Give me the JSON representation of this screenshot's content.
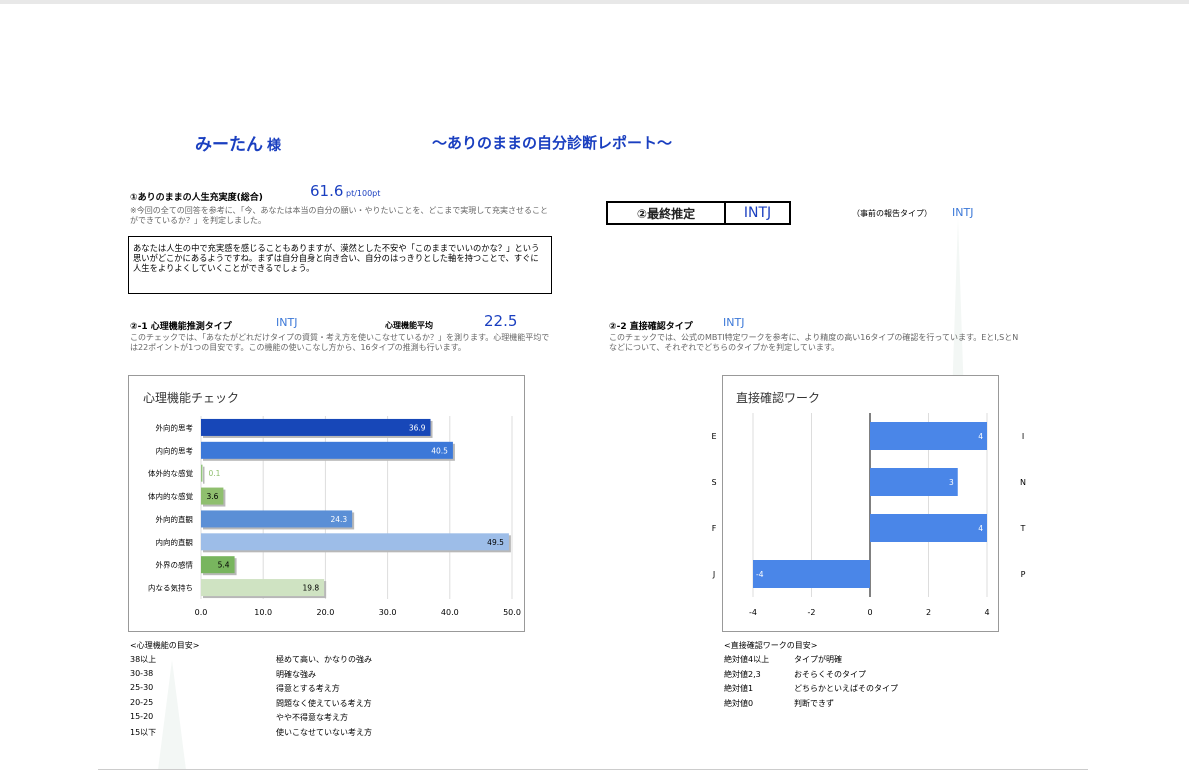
{
  "header": {
    "name": "みーたん",
    "honorific": "様",
    "title": "～ありのままの自分診断レポート～"
  },
  "section1": {
    "heading": "①ありのままの人生充実度(総合)",
    "score": "61.6",
    "unit": "pt/100pt",
    "note": "※今回の全ての回答を参考に、「今、あなたは本当の自分の願い・やりたいことを、どこまで実現して充実させることができているか？」を判定しました。",
    "message": "あなたは人生の中で充実感を感じることもありますが、漠然とした不安や「このままでいいのかな？」という思いがどこかにあるようですね。まずは自分自身と向き合い、自分のはっきりとした軸を持つことで、すぐに人生をよりよくしていくことができるでしょう。"
  },
  "section2": {
    "final_label": "②最終推定",
    "final_type": "INTJ",
    "prior_label": "（事前の報告タイプ）",
    "prior_type": "INTJ"
  },
  "section21": {
    "heading": "②-1 心理機能推測タイプ",
    "type": "INTJ",
    "avg_label": "心理機能平均",
    "avg_value": "22.5",
    "note": "このチェックでは、「あなたがどれだけタイプの資質・考え方を使いこなせているか？」を測ります。心理機能平均では22ポイントが1つの目安です。この機能の使いこなし方から、16タイプの推測も行います。"
  },
  "section22": {
    "heading": "②-2 直接確認タイプ",
    "type": "INTJ",
    "note": "このチェックでは、公式のMBTI特定ワークを参考に、より精度の高い16タイプの確認を行っています。EとI,SとNなどについて、それぞれでどちらのタイプかを判定しています。"
  },
  "chart_data": [
    {
      "type": "bar",
      "orientation": "horizontal",
      "title": "心理機能チェック",
      "categories": [
        "外向的思考",
        "内向的思考",
        "体外的な感覚",
        "体内的な感覚",
        "外向的直観",
        "内向的直観",
        "外界の感情",
        "内なる気持ち"
      ],
      "values": [
        36.9,
        40.5,
        0.1,
        3.6,
        24.3,
        49.5,
        5.4,
        19.8
      ],
      "value_labels": [
        "36.9",
        "40.5",
        "0.1",
        "3.6",
        "24.3",
        "49.5",
        "5.4",
        "19.8"
      ],
      "colors": [
        "#1747b8",
        "#3c78d8",
        "#93c47d",
        "#8fbf6e",
        "#5b8fd6",
        "#9dbde8",
        "#78b55e",
        "#cfe3c2"
      ],
      "xlim": [
        0,
        50
      ],
      "xticks": [
        "0.0",
        "10.0",
        "20.0",
        "30.0",
        "40.0",
        "50.0"
      ],
      "grid": true
    },
    {
      "type": "bar",
      "orientation": "horizontal",
      "title": "直接確認ワーク",
      "left_labels": [
        "E",
        "S",
        "F",
        "J"
      ],
      "right_labels": [
        "I",
        "N",
        "T",
        "P"
      ],
      "values": [
        4,
        3,
        4,
        -4
      ],
      "value_labels": [
        "4",
        "3",
        "4",
        "-4"
      ],
      "color": "#4a86e8",
      "xlim": [
        -4,
        4
      ],
      "xticks": [
        "-4",
        "-2",
        "0",
        "2",
        "4"
      ],
      "grid": true
    }
  ],
  "legend_func": {
    "title": "<心理機能の目安>",
    "rows": [
      {
        "range": "38以上",
        "desc": "極めて高い、かなりの強み"
      },
      {
        "range": "30-38",
        "desc": "明確な強み"
      },
      {
        "range": "25-30",
        "desc": "得意とする考え方"
      },
      {
        "range": "20-25",
        "desc": "問題なく使えている考え方"
      },
      {
        "range": "15-20",
        "desc": "やや不得意な考え方"
      },
      {
        "range": "15以下",
        "desc": "使いこなせていない考え方"
      }
    ]
  },
  "legend_direct": {
    "title": "<直接確認ワークの目安>",
    "rows": [
      {
        "range": "絶対値4以上",
        "desc": "タイプが明確"
      },
      {
        "range": "絶対値2,3",
        "desc": "おそらくそのタイプ"
      },
      {
        "range": "絶対値1",
        "desc": "どちらかといえばそのタイプ"
      },
      {
        "range": "絶対値0",
        "desc": "判断できず"
      }
    ]
  }
}
